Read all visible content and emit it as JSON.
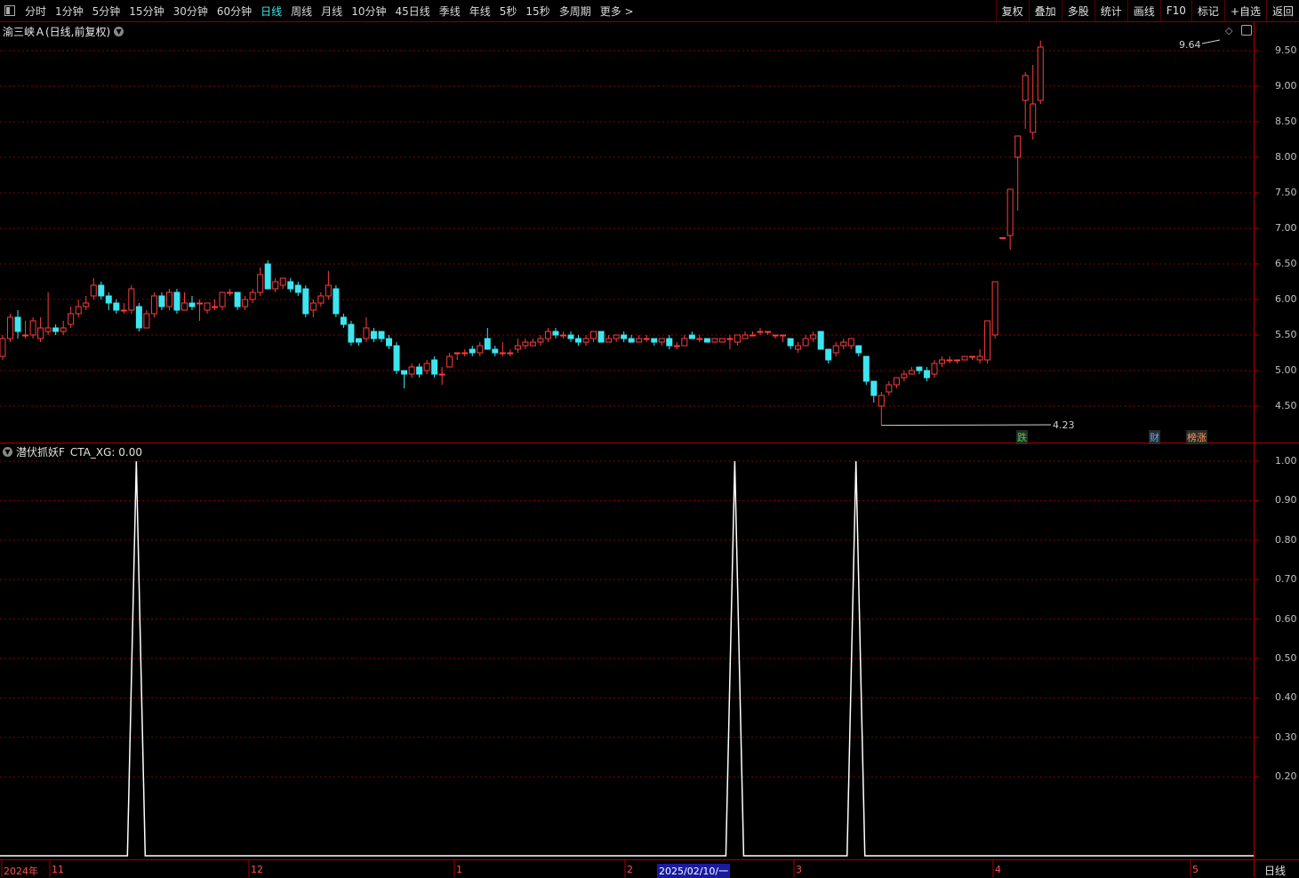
{
  "toolbar": {
    "periods": [
      "分时",
      "1分钟",
      "5分钟",
      "15分钟",
      "30分钟",
      "60分钟",
      "日线",
      "周线",
      "月线",
      "10分钟",
      "45日线",
      "季线",
      "年线",
      "5秒",
      "15秒",
      "多周期",
      "更多 >"
    ],
    "active_period": "日线",
    "tools": [
      "复权",
      "叠加",
      "多股",
      "统计",
      "画线",
      "F10",
      "标记",
      "+自选",
      "返回"
    ]
  },
  "price_panel": {
    "title": "渝三峡Ａ(日线,前复权)",
    "high_marker": "9.64",
    "low_marker": "4.23",
    "axis_ticks": [
      "9.50",
      "9.00",
      "8.50",
      "8.00",
      "7.50",
      "7.00",
      "6.50",
      "6.00",
      "5.50",
      "5.00",
      "4.50"
    ],
    "event_badges": [
      {
        "text": "跌",
        "color": "#3cd23c"
      },
      {
        "text": "财",
        "color": "#5aa8ff"
      },
      {
        "text": "榜涨",
        "color": "#ff9650"
      }
    ]
  },
  "indicator_panel": {
    "title": "潜伏抓妖F",
    "value_text": "CTA_XG: 0.00",
    "axis_ticks": [
      "1.00",
      "0.90",
      "0.80",
      "0.70",
      "0.60",
      "0.50",
      "0.40",
      "0.30",
      "0.20"
    ]
  },
  "date_axis": {
    "labels": [
      "2024年",
      "11",
      "12",
      "1",
      "2",
      "2025/02/10/一",
      "3",
      "4",
      "5"
    ],
    "period_label": "日线"
  },
  "colors": {
    "up": "#ff3c3c",
    "down": "#3ce6f0",
    "grid": "#8b0000",
    "separator": "#b00000",
    "active": "#42e6e6"
  },
  "chart_data": [
    {
      "type": "candlestick",
      "title": "渝三峡Ａ(日线,前复权)",
      "ylim": [
        4.05,
        9.8
      ],
      "candles": [
        [
          5.2,
          5.45,
          5.5,
          5.15
        ],
        [
          5.45,
          5.75,
          5.8,
          5.4
        ],
        [
          5.75,
          5.55,
          5.85,
          5.45
        ],
        [
          5.5,
          5.5,
          5.7,
          5.45
        ],
        [
          5.5,
          5.7,
          5.75,
          5.45
        ],
        [
          5.45,
          5.6,
          5.75,
          5.4
        ],
        [
          5.55,
          5.6,
          6.1,
          5.5
        ],
        [
          5.6,
          5.55,
          5.65,
          5.5
        ],
        [
          5.55,
          5.6,
          5.7,
          5.5
        ],
        [
          5.65,
          5.8,
          5.9,
          5.6
        ],
        [
          5.8,
          5.9,
          6.0,
          5.75
        ],
        [
          5.9,
          5.95,
          6.05,
          5.85
        ],
        [
          6.05,
          6.2,
          6.3,
          6.0
        ],
        [
          6.2,
          6.05,
          6.25,
          6.0
        ],
        [
          6.05,
          5.95,
          6.1,
          5.85
        ],
        [
          5.95,
          5.85,
          6.0,
          5.8
        ],
        [
          5.85,
          5.85,
          5.95,
          5.8
        ],
        [
          5.85,
          6.15,
          6.2,
          5.8
        ],
        [
          5.9,
          5.6,
          5.95,
          5.55
        ],
        [
          5.6,
          5.8,
          5.85,
          5.6
        ],
        [
          5.8,
          6.05,
          6.1,
          5.75
        ],
        [
          6.05,
          5.9,
          6.1,
          5.85
        ],
        [
          5.9,
          6.1,
          6.15,
          5.85
        ],
        [
          6.1,
          5.85,
          6.15,
          5.8
        ],
        [
          5.85,
          5.95,
          6.1,
          5.85
        ],
        [
          5.95,
          5.9,
          6.05,
          5.85
        ],
        [
          5.95,
          5.95,
          6.0,
          5.7
        ],
        [
          5.85,
          5.95,
          5.95,
          5.8
        ],
        [
          5.9,
          5.9,
          6.0,
          5.85
        ],
        [
          5.9,
          6.1,
          6.1,
          5.85
        ],
        [
          6.1,
          6.1,
          6.15,
          6.05
        ],
        [
          6.1,
          5.9,
          6.1,
          5.85
        ],
        [
          5.9,
          6.0,
          6.05,
          5.85
        ],
        [
          6.0,
          6.1,
          6.15,
          5.95
        ],
        [
          6.1,
          6.35,
          6.45,
          6.05
        ],
        [
          6.5,
          6.15,
          6.55,
          6.15
        ],
        [
          6.15,
          6.25,
          6.3,
          6.1
        ],
        [
          6.2,
          6.3,
          6.3,
          6.15
        ],
        [
          6.25,
          6.15,
          6.3,
          6.1
        ],
        [
          6.2,
          6.1,
          6.25,
          6.05
        ],
        [
          6.15,
          5.8,
          6.2,
          5.75
        ],
        [
          5.85,
          5.95,
          6.0,
          5.75
        ],
        [
          5.95,
          6.05,
          6.1,
          5.9
        ],
        [
          6.05,
          6.2,
          6.4,
          6.0
        ],
        [
          6.15,
          5.8,
          6.2,
          5.75
        ],
        [
          5.75,
          5.65,
          5.8,
          5.6
        ],
        [
          5.65,
          5.4,
          5.7,
          5.35
        ],
        [
          5.45,
          5.4,
          5.45,
          5.35
        ],
        [
          5.45,
          5.6,
          5.75,
          5.4
        ],
        [
          5.55,
          5.45,
          5.6,
          5.4
        ],
        [
          5.55,
          5.45,
          5.55,
          5.4
        ],
        [
          5.45,
          5.35,
          5.5,
          5.3
        ],
        [
          5.35,
          5.0,
          5.4,
          4.95
        ],
        [
          5.0,
          4.95,
          5.0,
          4.75
        ],
        [
          4.95,
          5.05,
          5.1,
          4.9
        ],
        [
          5.05,
          4.95,
          5.1,
          4.9
        ],
        [
          5.0,
          5.1,
          5.15,
          4.95
        ],
        [
          5.15,
          4.95,
          5.2,
          4.9
        ],
        [
          4.95,
          4.95,
          5.05,
          4.8
        ],
        [
          5.05,
          5.2,
          5.25,
          5.05
        ],
        [
          5.25,
          5.25,
          5.25,
          5.15
        ],
        [
          5.25,
          5.25,
          5.3,
          5.2
        ],
        [
          5.3,
          5.25,
          5.35,
          5.2
        ],
        [
          5.25,
          5.35,
          5.4,
          5.2
        ],
        [
          5.45,
          5.3,
          5.6,
          5.3
        ],
        [
          5.3,
          5.25,
          5.35,
          5.2
        ],
        [
          5.25,
          5.25,
          5.4,
          5.2
        ],
        [
          5.25,
          5.25,
          5.3,
          5.2
        ],
        [
          5.3,
          5.35,
          5.45,
          5.25
        ],
        [
          5.35,
          5.4,
          5.45,
          5.3
        ],
        [
          5.35,
          5.4,
          5.45,
          5.35
        ],
        [
          5.4,
          5.45,
          5.5,
          5.35
        ],
        [
          5.45,
          5.55,
          5.6,
          5.4
        ],
        [
          5.55,
          5.5,
          5.6,
          5.45
        ],
        [
          5.5,
          5.5,
          5.55,
          5.45
        ],
        [
          5.5,
          5.45,
          5.55,
          5.4
        ],
        [
          5.45,
          5.4,
          5.5,
          5.35
        ],
        [
          5.4,
          5.45,
          5.5,
          5.35
        ],
        [
          5.45,
          5.55,
          5.55,
          5.4
        ],
        [
          5.55,
          5.4,
          5.55,
          5.4
        ],
        [
          5.4,
          5.45,
          5.5,
          5.4
        ],
        [
          5.45,
          5.5,
          5.5,
          5.4
        ],
        [
          5.5,
          5.45,
          5.55,
          5.4
        ],
        [
          5.45,
          5.4,
          5.5,
          5.4
        ],
        [
          5.4,
          5.45,
          5.5,
          5.4
        ],
        [
          5.45,
          5.45,
          5.5,
          5.4
        ],
        [
          5.45,
          5.4,
          5.45,
          5.35
        ],
        [
          5.4,
          5.45,
          5.45,
          5.35
        ],
        [
          5.45,
          5.35,
          5.5,
          5.3
        ],
        [
          5.35,
          5.35,
          5.4,
          5.3
        ],
        [
          5.35,
          5.45,
          5.5,
          5.35
        ],
        [
          5.5,
          5.45,
          5.55,
          5.45
        ],
        [
          5.45,
          5.45,
          5.5,
          5.4
        ],
        [
          5.45,
          5.4,
          5.45,
          5.4
        ],
        [
          5.4,
          5.45,
          5.45,
          5.4
        ],
        [
          5.4,
          5.45,
          5.45,
          5.4
        ],
        [
          5.45,
          5.45,
          5.5,
          5.3
        ],
        [
          5.4,
          5.5,
          5.5,
          5.35
        ],
        [
          5.45,
          5.5,
          5.55,
          5.45
        ],
        [
          5.5,
          5.5,
          5.55,
          5.5
        ],
        [
          5.55,
          5.55,
          5.6,
          5.5
        ],
        [
          5.55,
          5.55,
          5.55,
          5.5
        ],
        [
          5.5,
          5.5,
          5.5,
          5.45
        ],
        [
          5.5,
          5.5,
          5.5,
          5.4
        ],
        [
          5.45,
          5.35,
          5.45,
          5.3
        ],
        [
          5.3,
          5.35,
          5.4,
          5.25
        ],
        [
          5.35,
          5.45,
          5.5,
          5.35
        ],
        [
          5.45,
          5.5,
          5.55,
          5.4
        ],
        [
          5.55,
          5.3,
          5.55,
          5.3
        ],
        [
          5.3,
          5.15,
          5.3,
          5.1
        ],
        [
          5.25,
          5.35,
          5.4,
          5.2
        ],
        [
          5.35,
          5.4,
          5.45,
          5.3
        ],
        [
          5.35,
          5.45,
          5.45,
          5.3
        ],
        [
          5.35,
          5.25,
          5.35,
          5.2
        ],
        [
          5.2,
          4.85,
          5.2,
          4.8
        ],
        [
          4.85,
          4.65,
          4.85,
          4.55
        ],
        [
          4.5,
          4.65,
          4.7,
          4.23
        ],
        [
          4.7,
          4.8,
          4.85,
          4.65
        ],
        [
          4.8,
          4.9,
          4.9,
          4.75
        ],
        [
          4.9,
          4.95,
          5.0,
          4.85
        ],
        [
          4.95,
          5.0,
          5.05,
          4.95
        ],
        [
          5.05,
          5.0,
          5.05,
          4.95
        ],
        [
          5.0,
          4.9,
          5.05,
          4.85
        ],
        [
          4.95,
          5.1,
          5.15,
          4.9
        ],
        [
          5.1,
          5.15,
          5.2,
          5.05
        ],
        [
          5.15,
          5.15,
          5.2,
          5.1
        ],
        [
          5.15,
          5.15,
          5.15,
          5.1
        ],
        [
          5.15,
          5.2,
          5.2,
          5.15
        ],
        [
          5.2,
          5.2,
          5.2,
          5.15
        ],
        [
          5.15,
          5.2,
          5.3,
          5.1
        ],
        [
          5.15,
          5.7,
          5.7,
          5.1
        ],
        [
          5.5,
          6.25,
          6.25,
          5.45
        ],
        [
          6.87,
          6.87,
          6.87,
          6.87
        ],
        [
          6.9,
          7.55,
          7.55,
          6.7
        ],
        [
          8.0,
          8.3,
          8.3,
          7.25
        ],
        [
          8.8,
          9.15,
          9.2,
          8.4
        ],
        [
          8.35,
          8.75,
          9.3,
          8.25
        ],
        [
          8.8,
          9.55,
          9.64,
          8.75
        ]
      ]
    },
    {
      "type": "line",
      "title": "潜伏抓妖F",
      "series": [
        {
          "name": "CTA_XG",
          "signal_indices": [
            16,
            95,
            111
          ],
          "values": "0 everywhere except 1 at signal_indices"
        }
      ],
      "ylim": [
        0,
        1
      ],
      "current_value": 0.0
    }
  ]
}
